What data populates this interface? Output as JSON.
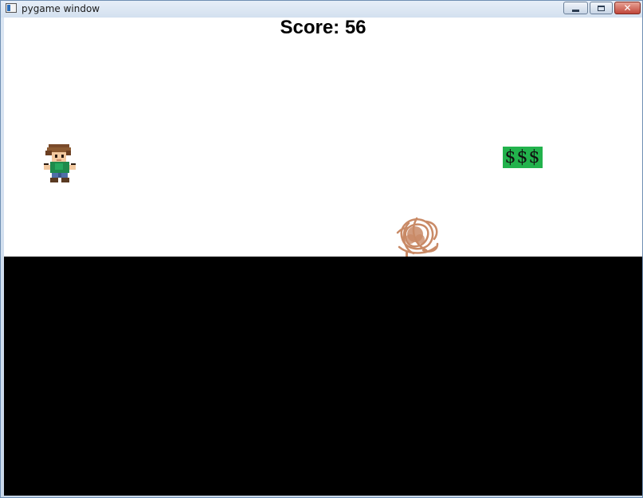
{
  "window": {
    "title": "pygame window",
    "controls": [
      "minimize",
      "maximize",
      "close"
    ]
  },
  "game": {
    "score_text": "Score: 56",
    "score": 56,
    "pickup_label": "$$$",
    "pickup_color": "#22b24c",
    "ground_color": "#000000",
    "background_color": "#ffffff",
    "obstacle_color": "#c98a66",
    "player": "pixel-art boy with brown hair and green shirt",
    "close_glyph": "✕"
  }
}
